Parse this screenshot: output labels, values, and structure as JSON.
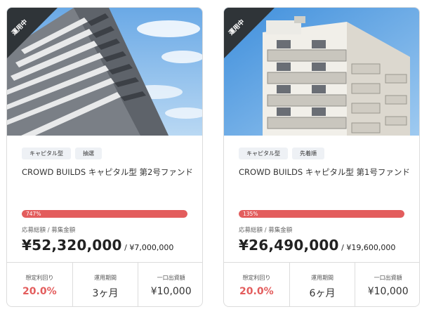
{
  "cards": [
    {
      "status_ribbon": "運用中",
      "tags": [
        "キャピタル型",
        "抽選"
      ],
      "title": "CROWD BUILDS キャピタル型 第2号ファンド",
      "progress_label": "747%",
      "progress_fill": 1.0,
      "amount_label": "応募総額 / 募集金額",
      "amount": "¥52,320,000",
      "amount_separator": " / ",
      "target": "¥7,000,000",
      "stats": [
        {
          "label": "想定利回り",
          "value": "20.0%"
        },
        {
          "label": "運用期間",
          "value": "3ヶ月"
        },
        {
          "label": "一口出資額",
          "value": "¥10,000"
        }
      ],
      "image": "building-photo-tall-concrete"
    },
    {
      "status_ribbon": "運用中",
      "tags": [
        "キャピタル型",
        "先着順"
      ],
      "title": "CROWD BUILDS キャピタル型 第1号ファンド",
      "progress_label": "135%",
      "progress_fill": 1.0,
      "amount_label": "応募総額 / 募集金額",
      "amount": "¥26,490,000",
      "amount_separator": " / ",
      "target": "¥19,600,000",
      "stats": [
        {
          "label": "想定利回り",
          "value": "20.0%"
        },
        {
          "label": "運用期間",
          "value": "6ヶ月"
        },
        {
          "label": "一口出資額",
          "value": "¥10,000"
        }
      ],
      "image": "building-photo-white-apartment"
    }
  ],
  "colors": {
    "accent_red": "#e35d5d",
    "ribbon": "#2f3438",
    "tag_bg": "#eef1f5",
    "border": "#dcdcdc"
  }
}
